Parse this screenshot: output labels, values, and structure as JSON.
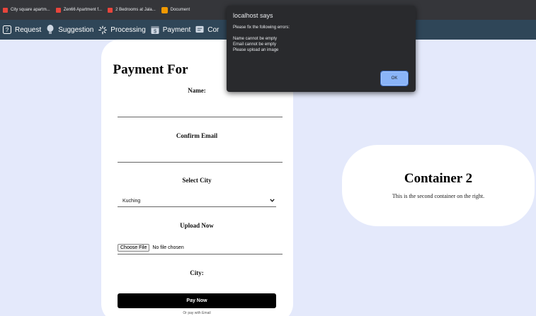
{
  "bookmarks": [
    {
      "label": "City square apartm...",
      "icon": "airbnb-icon"
    },
    {
      "label": "Zen66 Apartment f...",
      "icon": "airbnb-icon"
    },
    {
      "label": "2 Bedrooms at Jala...",
      "icon": "airbnb-icon"
    },
    {
      "label": "Document",
      "icon": "document-icon"
    }
  ],
  "nav": {
    "items": [
      {
        "label": "Request",
        "icon": "question-icon"
      },
      {
        "label": "Suggestion",
        "icon": "lightbulb-icon"
      },
      {
        "label": "Processing",
        "icon": "spinner-icon"
      },
      {
        "label": "Payment",
        "icon": "payment-icon"
      },
      {
        "label": "Cor",
        "icon": "chat-icon"
      }
    ]
  },
  "form": {
    "title": "Payment For",
    "name_label": "Name:",
    "email_label": "Confirm Email",
    "city_select_label": "Select City",
    "city_selected": "Kuching",
    "upload_label": "Upload Now",
    "choose_file": "Choose File",
    "no_file": "No file chosen",
    "city_label": "City:",
    "pay_button": "Pay Now",
    "footer_tiny": "Or pay with Email"
  },
  "container2": {
    "title": "Container 2",
    "text": "This is the second container on the right."
  },
  "dialog": {
    "title": "localhost says",
    "message": "Please fix the following errors:",
    "errors": [
      "Name cannot be empty",
      "Email cannot be empty",
      "Please upload an image"
    ],
    "ok_label": "OK"
  },
  "colors": {
    "nav_bg": "#2f4658",
    "page_bg": "#e4e9fb",
    "dialog_bg": "#292a2d",
    "ok_button": "#8ab4f8"
  }
}
